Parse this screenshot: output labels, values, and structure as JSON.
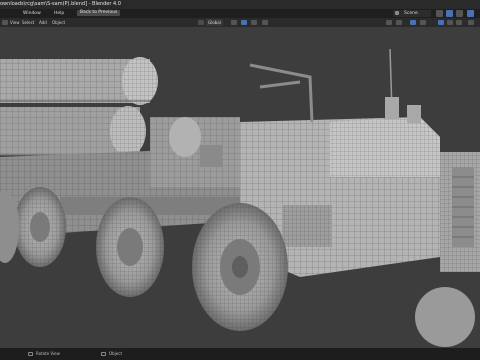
{
  "window": {
    "title": "ownloads\\rcg\\sam\\S-sam(P).blend] - Blender 4.0"
  },
  "topbar": {
    "menu": [
      "Window",
      "Help"
    ],
    "back_button": "Back to Previous",
    "scene_label": "Scene"
  },
  "header": {
    "items": [
      "View",
      "Select",
      "Add",
      "Object"
    ],
    "transform_orientation": "Global"
  },
  "statusbar": {
    "left_label": "Rotate View",
    "right_label": "Object"
  },
  "colors": {
    "ui_dark": "#1f1f1f",
    "ui_mid": "#2b2b2b",
    "viewport_bg": "#3d3d3d",
    "accent_blue": "#4772b3",
    "back_button": "#4a4a4a"
  },
  "icons": [
    "editor-type-icon",
    "global-orientation-icon",
    "snap-icon",
    "scene-icon",
    "view-layer-icon",
    "gizmo-icon",
    "overlay-icon",
    "shading-icon"
  ]
}
